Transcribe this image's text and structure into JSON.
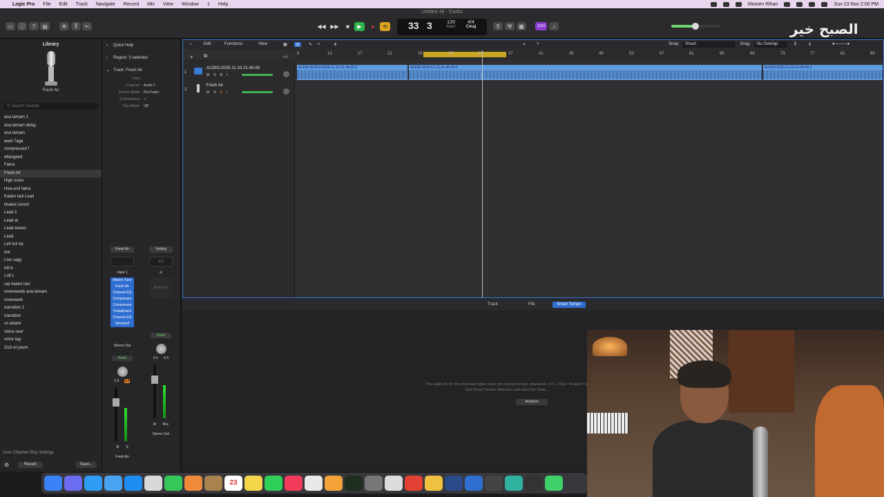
{
  "menubar": {
    "app_name": "Logic Pro",
    "items": [
      "File",
      "Edit",
      "Track",
      "Navigate",
      "Record",
      "Mix",
      "View",
      "Window",
      "1",
      "Help"
    ],
    "user": "Momen Rihan",
    "datetime": "Sun 23 Nov  2:00 PM"
  },
  "window": {
    "title": "Untitled 49 - Tracks"
  },
  "lcd": {
    "bar": "33",
    "beat": "3",
    "tempo": "120",
    "tempo_label": "KEEP",
    "signature": "4/4",
    "key": "Cmaj",
    "count_in_badge": "1234"
  },
  "library": {
    "title": "Library",
    "patch_name": "Fresh Air",
    "search_placeholder": "Search Sounds",
    "items": [
      "ana tamam 1",
      "ana tamam delay",
      "ana tamam",
      "awel 7aga",
      "compressed f",
      "eltangeed",
      "Fakra",
      "Fresh Air",
      "High octav",
      "Hwa enti fakra",
      "Kalam tani Lead",
      "khaled zoroof",
      "Lead 2",
      "Lead at",
      "Lead waves",
      "Lead",
      "Leh kol da",
      "live",
      "Live sagy",
      "lofi b",
      "Lofi L",
      "rap kalam tani",
      "revereeeeb ana tamam",
      "revereeeb",
      "transition 1",
      "transition",
      "vo ebank",
      "Voice over",
      "voice tag",
      "Zo2i el youm"
    ],
    "selected": "Fresh Air",
    "footer_label": "User Channel Strip Settings",
    "revert_label": "Revert",
    "save_label": "Save..."
  },
  "inspector": {
    "quick_help": "Quick Help",
    "region_label": "Region: 3 selected",
    "track_label": "Track:  Fresh Air",
    "fields": [
      {
        "k": "Icon:",
        "v": ""
      },
      {
        "k": "Channel:",
        "v": "Audio 1"
      },
      {
        "k": "Freeze Mode:",
        "v": "Pre Fader"
      },
      {
        "k": "Q-Reference:",
        "v": "✓"
      },
      {
        "k": "Flex Mode:",
        "v": "Off"
      }
    ],
    "strip1": {
      "name": "Fresh Air",
      "input": "Input 1",
      "plugins": [
        "Waves Tune",
        "Fresh Air",
        "Channel EQ",
        "Compressor",
        "Compressor",
        "Pedalboard",
        "Channel EQ",
        "VelvetaVI"
      ],
      "output": "Stereo Out",
      "automation": "Read",
      "val_a": "5.5",
      "val_b": "0.8",
      "mute": "M",
      "solo": "S",
      "label": "Fresh Air"
    },
    "strip2": {
      "name": "Setting",
      "eq": "EQ",
      "audio_fx": "Audio FX",
      "automation": "Read",
      "val_a": "0.0",
      "val_b": "-6.5",
      "mute": "M",
      "bnc": "Bnc",
      "label": "Stereo Out"
    }
  },
  "tracks_toolbar": {
    "edit": "Edit",
    "functions": "Functions",
    "view": "View",
    "snap_label": "Snap:",
    "snap_value": "Smart",
    "drag_label": "Drag:",
    "drag_value": "No Overlap"
  },
  "ruler": {
    "ticks": [
      "9",
      "13",
      "17",
      "21",
      "25",
      "29",
      "33",
      "37",
      "41",
      "45",
      "49",
      "53",
      "57",
      "61",
      "65",
      "69",
      "73",
      "77",
      "81",
      "85"
    ]
  },
  "tracks": [
    {
      "number": "1",
      "name": "AUDIO-2025-11-10-21-40-00",
      "mute": "M",
      "solo": "S",
      "record": "R",
      "input": "I"
    },
    {
      "number": "2",
      "name": "Fresh Air",
      "mute": "M",
      "solo": "S",
      "record": "R",
      "input": "I"
    }
  ],
  "regions": [
    {
      "title": "AUDIO  AUDIO-2025-11-10-21-39-33.2"
    },
    {
      "title": "AUDIO-2025-11-10-21-40-00.2"
    },
    {
      "title": "AUDIO-2025-11-10-21-40-00.2"
    }
  ],
  "editor": {
    "tabs": [
      "Track",
      "File",
      "Smart Tempo"
    ],
    "active_tab": "Smart Tempo",
    "message": "The audio file for the selected region does not contain tempo, downbeat, or ti... Click \"Analyze\" to start Smart Tempo detection and open the Smar...",
    "analyze": "Analyze"
  },
  "watermark": "الصبح خير",
  "dock": {
    "calendar_day": "23"
  }
}
